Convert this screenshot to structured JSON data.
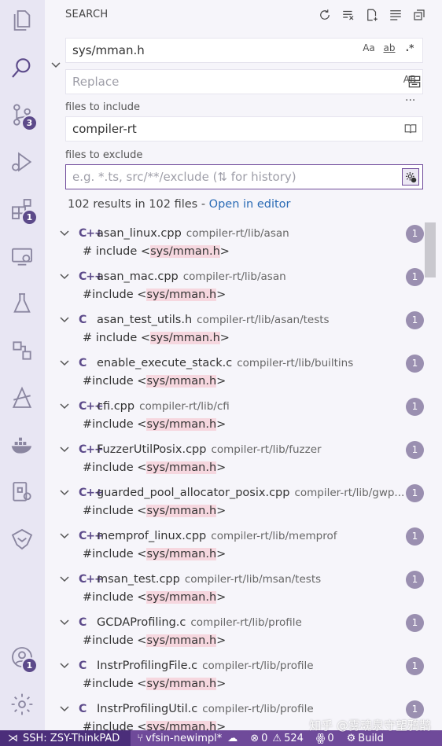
{
  "activity_bar": {
    "items": [
      {
        "icon": "files-icon"
      },
      {
        "icon": "search-icon"
      },
      {
        "icon": "source-control-icon",
        "badge": "3"
      },
      {
        "icon": "run-debug-icon"
      },
      {
        "icon": "extensions-icon",
        "badge": "1"
      },
      {
        "icon": "remote-explorer-icon"
      },
      {
        "icon": "testing-icon"
      },
      {
        "icon": "references-icon"
      },
      {
        "icon": "compass-icon"
      },
      {
        "icon": "docker-icon"
      },
      {
        "icon": "remote-settings-icon"
      },
      {
        "icon": "cmake-icon"
      }
    ],
    "account_badge": "1"
  },
  "search": {
    "title": "SEARCH",
    "query": "sys/mman.h",
    "match_case": "Aa",
    "whole_word": "ab",
    "regex": ".*",
    "replace_placeholder": "Replace",
    "preserve_case": "AB",
    "files_to_include_label": "files to include",
    "files_to_include_value": "compiler-rt",
    "files_to_exclude_label": "files to exclude",
    "files_to_exclude_placeholder": "e.g. *.ts, src/**/exclude (⇅ for history)",
    "more": "···"
  },
  "summary": {
    "text": "102 results in 102 files - ",
    "open_in_editor": "Open in editor"
  },
  "results": [
    {
      "type": "C++",
      "name": "asan_linux.cpp",
      "path": "compiler-rt/lib/asan",
      "count": "1",
      "prefix": "#  include <",
      "match": "sys/mman.h",
      "suffix": ">"
    },
    {
      "type": "C++",
      "name": "asan_mac.cpp",
      "path": "compiler-rt/lib/asan",
      "count": "1",
      "prefix": "#include <",
      "match": "sys/mman.h",
      "suffix": ">"
    },
    {
      "type": "C",
      "name": "asan_test_utils.h",
      "path": "compiler-rt/lib/asan/tests",
      "count": "1",
      "prefix": "# include <",
      "match": "sys/mman.h",
      "suffix": ">"
    },
    {
      "type": "C",
      "name": "enable_execute_stack.c",
      "path": "compiler-rt/lib/builtins",
      "count": "1",
      "prefix": "#include <",
      "match": "sys/mman.h",
      "suffix": ">"
    },
    {
      "type": "C++",
      "name": "cfi.cpp",
      "path": "compiler-rt/lib/cfi",
      "count": "1",
      "prefix": "#include <",
      "match": "sys/mman.h",
      "suffix": ">"
    },
    {
      "type": "C++",
      "name": "FuzzerUtilPosix.cpp",
      "path": "compiler-rt/lib/fuzzer",
      "count": "1",
      "prefix": "#include <",
      "match": "sys/mman.h",
      "suffix": ">"
    },
    {
      "type": "C++",
      "name": "guarded_pool_allocator_posix.cpp",
      "path": "compiler-rt/lib/gwp...",
      "count": "1",
      "prefix": "#include <",
      "match": "sys/mman.h",
      "suffix": ">"
    },
    {
      "type": "C++",
      "name": "memprof_linux.cpp",
      "path": "compiler-rt/lib/memprof",
      "count": "1",
      "prefix": "#include <",
      "match": "sys/mman.h",
      "suffix": ">"
    },
    {
      "type": "C++",
      "name": "msan_test.cpp",
      "path": "compiler-rt/lib/msan/tests",
      "count": "1",
      "prefix": "#include <",
      "match": "sys/mman.h",
      "suffix": ">"
    },
    {
      "type": "C",
      "name": "GCDAProfiling.c",
      "path": "compiler-rt/lib/profile",
      "count": "1",
      "prefix": "#include <",
      "match": "sys/mman.h",
      "suffix": ">"
    },
    {
      "type": "C",
      "name": "InstrProfilingFile.c",
      "path": "compiler-rt/lib/profile",
      "count": "1",
      "prefix": "#include <",
      "match": "sys/mman.h",
      "suffix": ">"
    },
    {
      "type": "C",
      "name": "InstrProfilingUtil.c",
      "path": "compiler-rt/lib/profile",
      "count": "1",
      "prefix": "#include <",
      "match": "sys/mman.h",
      "suffix": ">"
    }
  ],
  "statusbar": {
    "remote": "SSH: ZSY-ThinkPAD",
    "branch": "vfsin-newimpl*",
    "errors": "0",
    "warnings": "524",
    "ports": "0",
    "build": "Build"
  },
  "watermark": "知乎 @雾魂泉守望鸦鹊",
  "colors": {
    "accent": "#6f4a9a",
    "badge": "#5c4a8a",
    "highlight": "#f6d7df",
    "link": "#2a6bb5"
  }
}
